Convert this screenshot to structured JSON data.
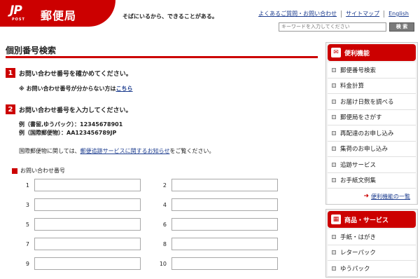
{
  "header": {
    "logo_mark": "JP",
    "logo_post": "POST",
    "logo_name": "郵便局",
    "tagline": "そばにいるから、できることがある。",
    "util_links": [
      "よくあるご質問・お問い合わせ",
      "サイトマップ",
      "English"
    ],
    "search": {
      "placeholder": "キーワードを入力してください",
      "button": "検 索"
    }
  },
  "main": {
    "title": "個別番号検索",
    "step1": {
      "num": "1",
      "text": "お問い合わせ番号を確かめてください。"
    },
    "note": {
      "prefix": "※ お問い合わせ番号が分からない方は",
      "link": "こちら"
    },
    "step2": {
      "num": "2",
      "text": "お問い合わせ番号を入力してください。"
    },
    "examples": [
      "例（書留,ゆうパック）：12345678901",
      "例（国際郵便物）：AA123456789JP"
    ],
    "intl": {
      "prefix": "国際郵便物に関しては、",
      "link": "郵便追跡サービスに関するお知らせ",
      "suffix": "をご覧ください。"
    },
    "field_label": "お問い合わせ番号",
    "inputs": [
      {
        "left": "1",
        "right": "2"
      },
      {
        "left": "3",
        "right": "4"
      },
      {
        "left": "5",
        "right": "6"
      },
      {
        "left": "7",
        "right": "8"
      },
      {
        "left": "9",
        "right": "10"
      }
    ]
  },
  "sidebar": {
    "convenience": {
      "title": "便利機能",
      "items": [
        "郵便番号検索",
        "料金計算",
        "お届け日数を調べる",
        "郵便局をさがす",
        "再配達のお申し込み",
        "集荷のお申し込み",
        "追跡サービス",
        "お手紙文例集"
      ],
      "more": "便利機能の一覧"
    },
    "products": {
      "title": "商品・サービス",
      "items": [
        "手紙・はがき",
        "レターパック",
        "ゆうパック"
      ]
    }
  },
  "colors": {
    "brand_red": "#cc0000",
    "link_blue": "#1d3d8f"
  }
}
